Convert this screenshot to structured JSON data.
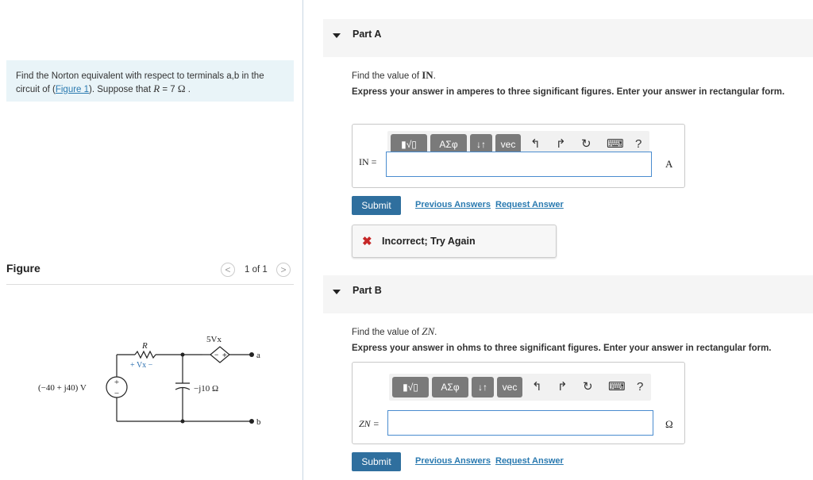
{
  "problem": {
    "text_before": "Find the Norton equivalent with respect to terminals a,b in the circuit of (",
    "figure_link": "Figure 1",
    "text_after": "). Suppose that ",
    "var": "R",
    "eq": " = 7 ",
    "unit": "Ω",
    "end": " ."
  },
  "figure": {
    "title": "Figure",
    "pager": "1 of 1",
    "prev_icon": "chevron-left",
    "next_icon": "chevron-right",
    "circuit": {
      "source_label": "(−40 + j40) V",
      "resistor_label": "R",
      "vx_label": "+  Vx  −",
      "dep_source_label": "5Vx",
      "cap_label": "−j10 Ω",
      "terminal_a": "a",
      "terminal_b": "b"
    }
  },
  "toolbar": {
    "templates_label": "▮√▯",
    "greek_label": "ΑΣφ",
    "arrows_label": "↓↑",
    "vec_label": "vec",
    "undo_icon": "↰",
    "redo_icon": "↱",
    "reset_icon": "↻",
    "keyboard_icon": "⌨",
    "help_label": "?"
  },
  "partA": {
    "title": "Part A",
    "question_prefix": "Find the value of ",
    "question_var": "IN",
    "question_suffix": ".",
    "instructions": "Express your answer in amperes to three significant figures. Enter your answer in rectangular form.",
    "answer_label": "IN =",
    "answer_value": "",
    "unit": "A",
    "submit": "Submit",
    "prev_answers": "Previous Answers",
    "request_answer": "Request Answer",
    "feedback": "Incorrect; Try Again"
  },
  "partB": {
    "title": "Part B",
    "question_prefix": "Find the value of ",
    "question_var": "ZN",
    "question_suffix": ".",
    "instructions": "Express your answer in ohms to three significant figures. Enter your answer in rectangular form.",
    "answer_label": "ZN =",
    "answer_value": "",
    "unit": "Ω",
    "submit": "Submit",
    "prev_answers": "Previous Answers",
    "request_answer": "Request Answer"
  },
  "colors": {
    "accent": "#2f6f9e",
    "link": "#2a7ab0",
    "problem_bg": "#e9f4f8",
    "error": "#c62828"
  }
}
